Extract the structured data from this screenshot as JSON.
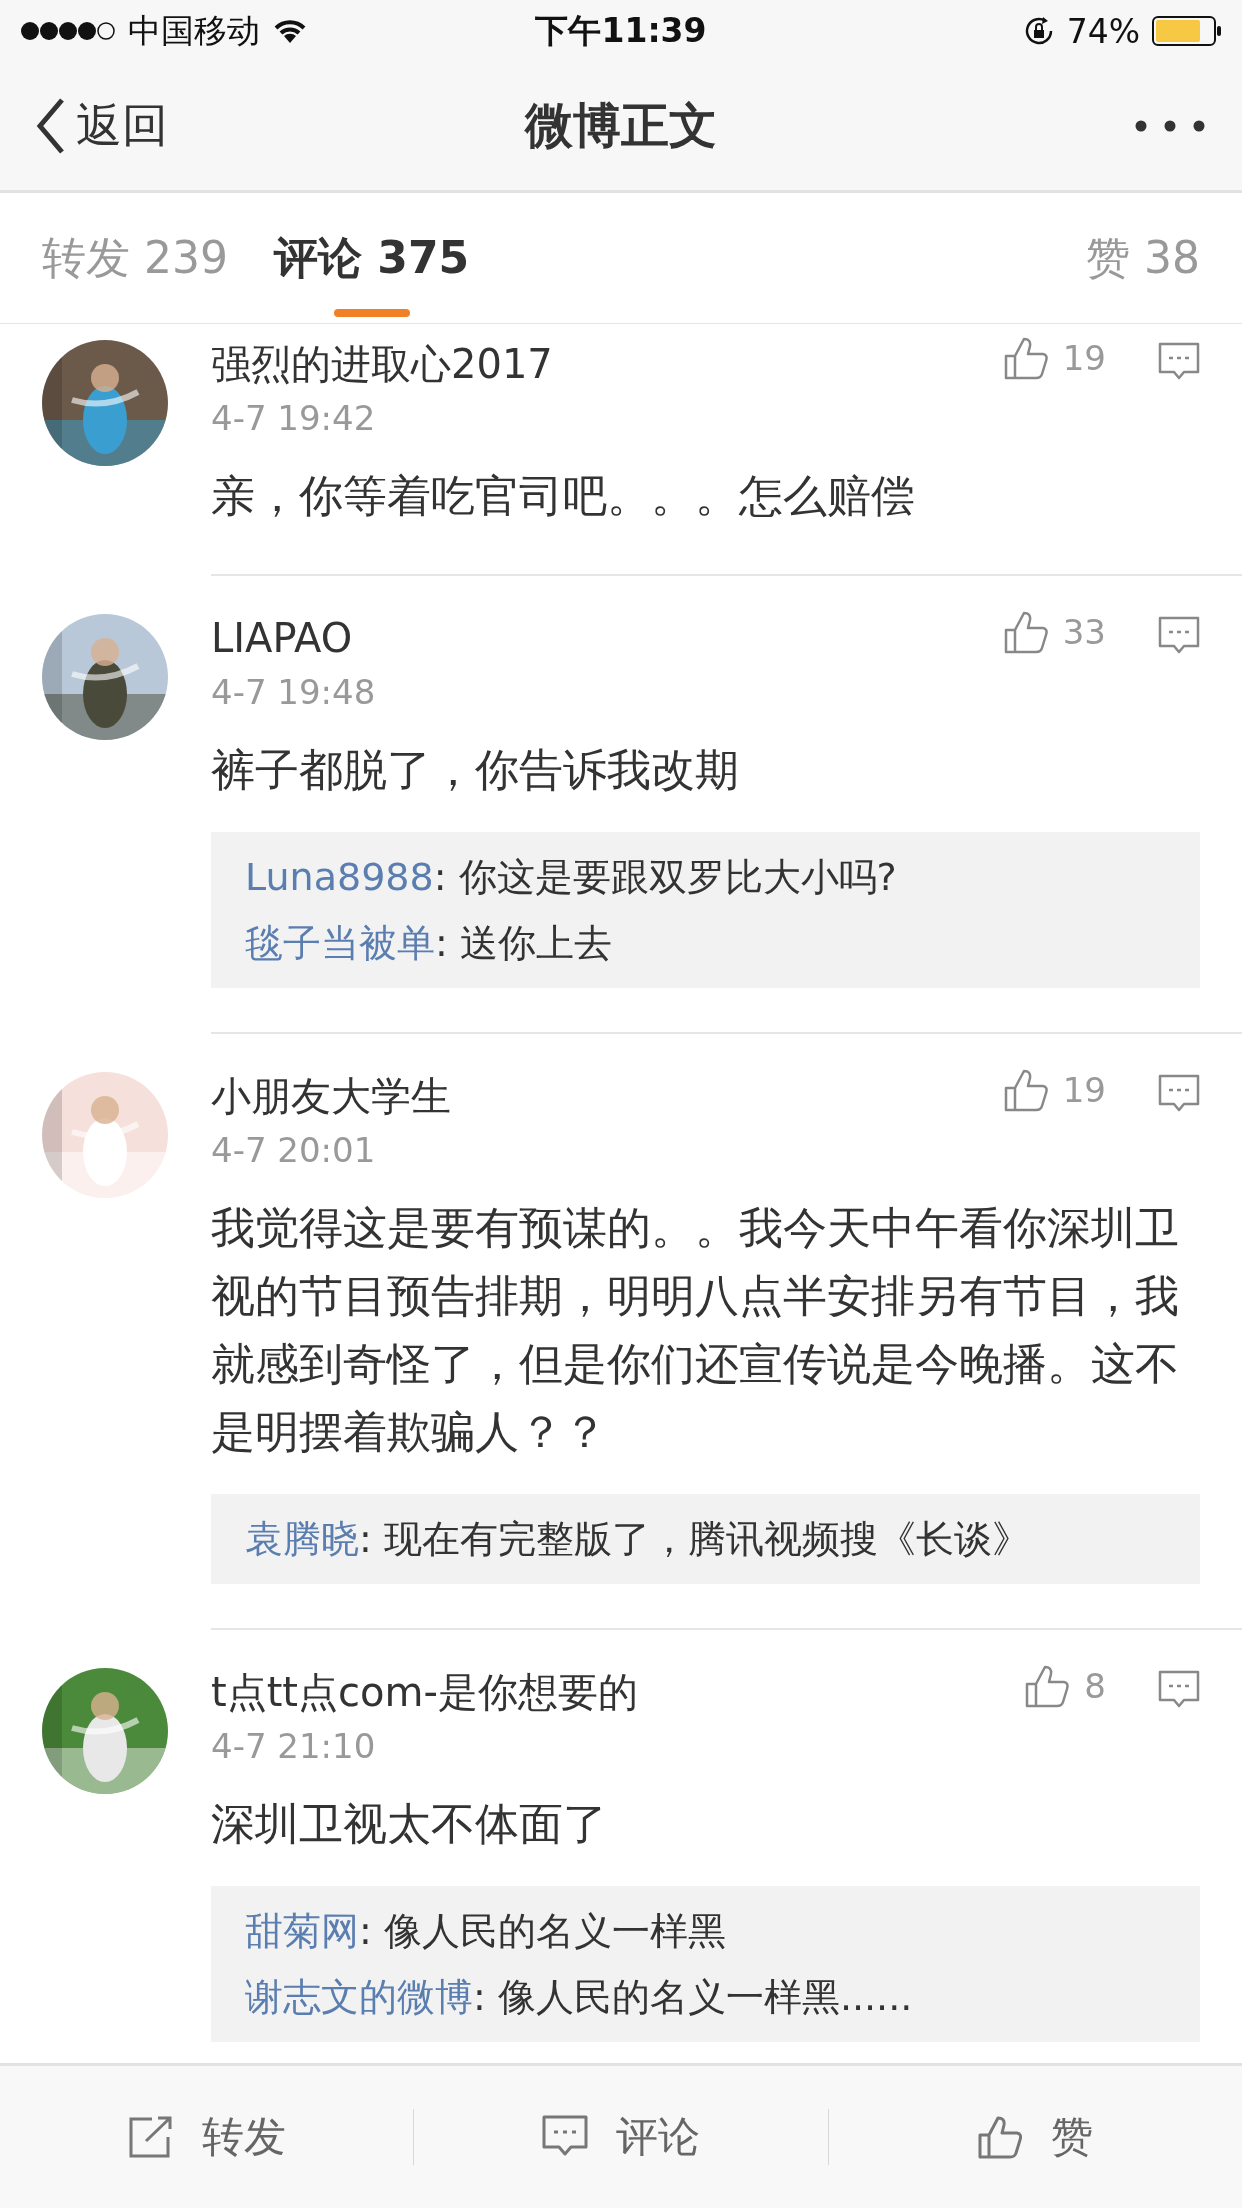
{
  "status_bar": {
    "carrier": "中国移动",
    "time": "下午11:39",
    "battery": "74%"
  },
  "nav": {
    "back": "返回",
    "title": "微博正文"
  },
  "tabs": [
    {
      "label": "转发 239",
      "selected": false
    },
    {
      "label": "评论 375",
      "selected": true
    },
    {
      "label": "赞 38",
      "selected": false
    }
  ],
  "comments": [
    {
      "name": "强烈的进取心2017",
      "time": "4-7 19:42",
      "likes": "19",
      "text": "亲，你等着吃官司吧。。。怎么赔偿",
      "avatar": {
        "kind": "picture"
      }
    },
    {
      "name": "LIAPAO",
      "time": "4-7 19:48",
      "likes": "33",
      "text": "裤子都脱了，你告诉我改期",
      "replies": [
        {
          "user": "Luna8988",
          "text": ": 你这是要跟双罗比大小吗?"
        },
        {
          "user": "毯子当被单",
          "text": ": 送你上去"
        }
      ],
      "avatar": {
        "kind": "picture"
      }
    },
    {
      "name": "小朋友大学生",
      "time": "4-7 20:01",
      "likes": "19",
      "text": "我觉得这是要有预谋的。。我今天中午看你深圳卫视的节目预告排期，明明八点半安排另有节目，我就感到奇怪了，但是你们还宣传说是今晚播。这不是明摆着欺骗人？？",
      "replies": [
        {
          "user": "袁腾晓",
          "text": ": 现在有完整版了，腾讯视频搜《长谈》"
        }
      ],
      "avatar": {
        "kind": "picture"
      }
    },
    {
      "name": "t点tt点com-是你想要的",
      "time": "4-7 21:10",
      "likes": "8",
      "text": "深圳卫视太不体面了",
      "replies": [
        {
          "user": "甜菊网",
          "text": ": 像人民的名义一样黑"
        },
        {
          "user": "谢志文的微博",
          "text": ": 像人民的名义一样黑......"
        }
      ],
      "avatar": {
        "kind": "picture"
      }
    }
  ],
  "toolbar": [
    {
      "kind": "share",
      "label": "转发"
    },
    {
      "kind": "comment",
      "label": "评论"
    },
    {
      "kind": "like",
      "label": "赞"
    }
  ]
}
